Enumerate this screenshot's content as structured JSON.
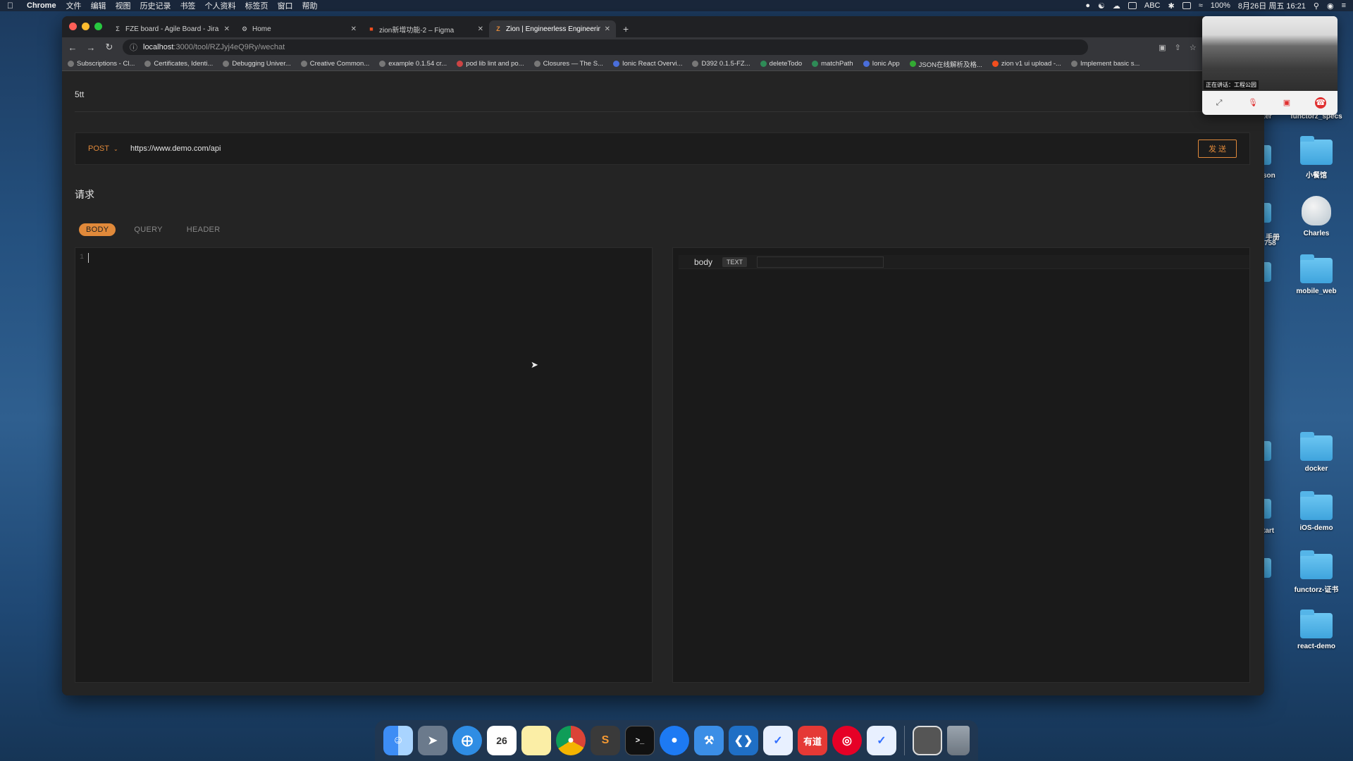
{
  "menubar": {
    "app": "Chrome",
    "items": [
      "文件",
      "编辑",
      "视图",
      "历史记录",
      "书签",
      "个人资料",
      "标签页",
      "窗口",
      "帮助"
    ],
    "right": {
      "input": "ABC",
      "battery": "100%",
      "datetime": "8月26日 周五 16:21"
    }
  },
  "desktop": {
    "items": [
      {
        "label": "functorz_specs",
        "kind": "folder"
      },
      {
        "label": "小餐馆",
        "kind": "folder"
      },
      {
        "label": "Charles",
        "kind": "app"
      },
      {
        "label": "mobile_web",
        "kind": "folder"
      },
      {
        "label": "docker",
        "kind": "folder"
      },
      {
        "label": "iOS-demo",
        "kind": "folder"
      },
      {
        "label": "functorz-证书",
        "kind": "folder"
      },
      {
        "label": "react-demo",
        "kind": "folder"
      }
    ],
    "partial_labels": [
      "ter",
      "son",
      "手册",
      "758",
      "tart"
    ]
  },
  "browser": {
    "tabs": [
      {
        "title": "FZE board - Agile Board - Jira",
        "favicon": "jira-icon",
        "active": false
      },
      {
        "title": "Home",
        "favicon": "gear-icon",
        "active": false
      },
      {
        "title": "zion新增功能-2 – Figma",
        "favicon": "figma-icon",
        "active": false
      },
      {
        "title": "Zion | Engineerless Engineerin",
        "favicon": "zion-icon",
        "active": true
      }
    ],
    "url_host": "localhost",
    "url_rest": ":3000/tool/RZJyj4eQ9Ry/wechat",
    "bookmarks": [
      "Subscriptions - Cl...",
      "Certificates, Identi...",
      "Debugging Univer...",
      "Creative Common...",
      "example 0.1.54 cr...",
      "pod lib lint and po...",
      "Closures — The S...",
      "Ionic React Overvi...",
      "D392 0.1.5-FZ...",
      "deleteTodo",
      "matchPath",
      "Ionic App",
      "JSON在线解析及格...",
      "zion v1 ui upload -...",
      "Implement basic s..."
    ]
  },
  "page": {
    "title": "5tt",
    "method": "POST",
    "url": "https://www.demo.com/api",
    "send_label": "发 送",
    "section_label": "请求",
    "tabs": [
      "BODY",
      "QUERY",
      "HEADER"
    ],
    "active_tab": "BODY",
    "editor_line": "1",
    "response_label": "body",
    "response_type": "TEXT"
  },
  "call": {
    "status": "正在讲话：工程公园"
  },
  "dock": {
    "apps": [
      "finder",
      "launchpad",
      "safari",
      "calendar",
      "notes",
      "chrome",
      "sublime",
      "terminal",
      "maps",
      "xcode",
      "vscode",
      "lark",
      "youdao",
      "netease-music",
      "lark-2",
      "screenshot",
      "trash"
    ],
    "calendar_day": "26",
    "youdao_label": "有道"
  },
  "colors": {
    "accent": "#e0893a",
    "page_bg": "#242424",
    "panel_bg": "#1a1a1a"
  }
}
